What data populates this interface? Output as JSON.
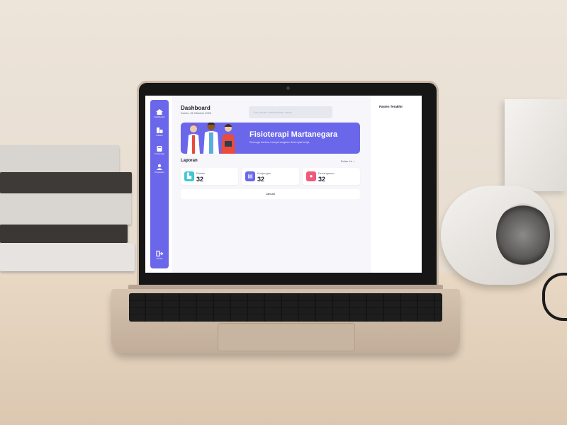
{
  "sidebar": {
    "items": [
      {
        "label": "Dashboard",
        "icon": "home-icon"
      },
      {
        "label": "Pasien",
        "icon": "patient-icon"
      },
      {
        "label": "Kunjungan",
        "icon": "visit-icon"
      },
      {
        "label": "Karyawan",
        "icon": "employee-icon"
      }
    ],
    "logout_label": "Keluar"
  },
  "header": {
    "title": "Dashboard",
    "date": "Kamis, 26 Oktober 2023",
    "search_placeholder": "Cari pasien berdasarkan nama"
  },
  "banner": {
    "title": "Fisioterapi Martanegara",
    "subtitle": "Semoga harimu menyenangkan di tempat kerja."
  },
  "report": {
    "title": "Laporan",
    "filter": "Bulan Ini",
    "cards": [
      {
        "label": "Pasien",
        "value": "32",
        "color": "#3ec6d6",
        "icon": "building-icon"
      },
      {
        "label": "Kunjungan",
        "value": "32",
        "color": "#6b67ea",
        "icon": "clipboard-icon"
      },
      {
        "label": "Penanganan",
        "value": "32",
        "color": "#ee5a7a",
        "icon": "person-icon"
      }
    ],
    "month": "Januari"
  },
  "right_panel": {
    "title": "Pasien Terakhir"
  },
  "colors": {
    "accent": "#6b67ea",
    "background": "#f6f6fb"
  }
}
